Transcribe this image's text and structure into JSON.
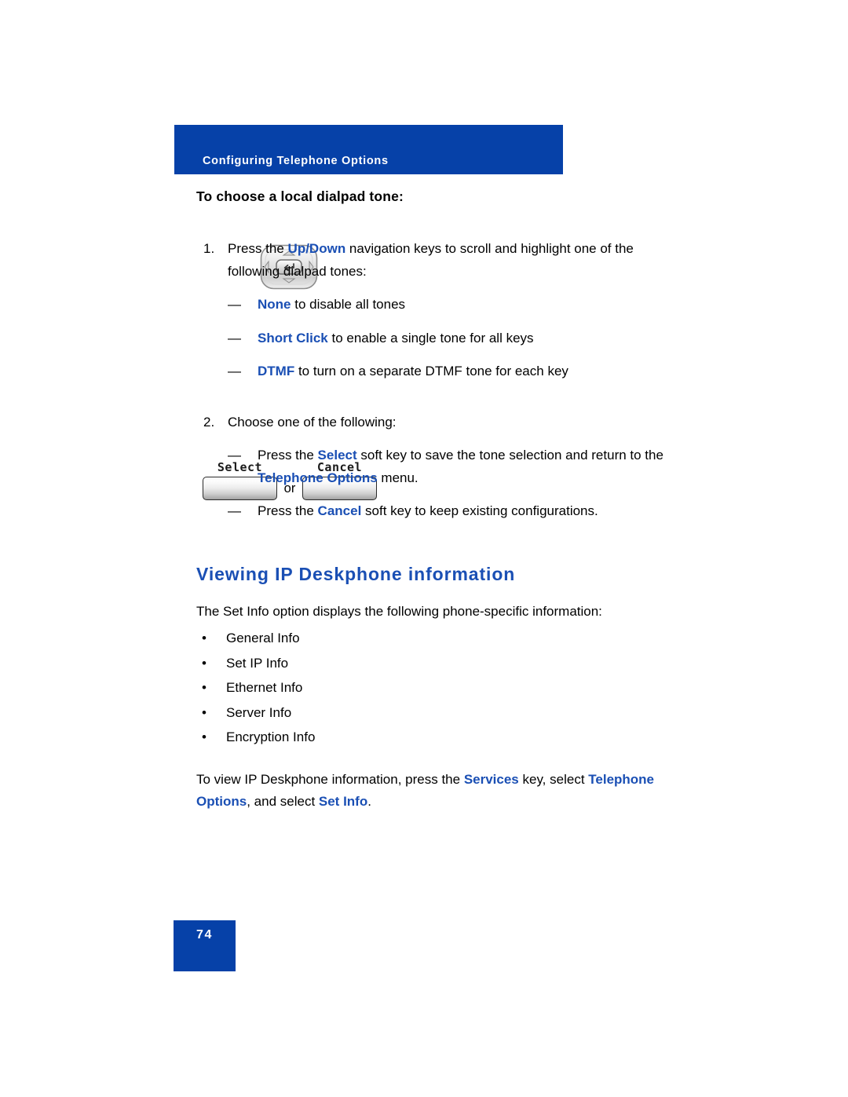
{
  "header": {
    "running_head": "Configuring Telephone Options"
  },
  "procedure": {
    "title": "To choose a local dialpad tone:",
    "steps": [
      {
        "number": "1.",
        "lead_pre": "Press the ",
        "lead_bold": "Up/Down",
        "lead_post": " navigation keys to scroll and highlight one of the following dialpad tones:",
        "dash": "—",
        "substeps": [
          {
            "bold": "None",
            "text": " to disable all tones"
          },
          {
            "bold": "Short Click",
            "text": " to enable a single tone for all keys"
          },
          {
            "bold": "DTMF",
            "text": " to turn on a separate DTMF tone for each key"
          }
        ]
      },
      {
        "number": "2.",
        "lead_pre": "Choose one of the following:",
        "lead_bold": "",
        "lead_post": "",
        "dash": "—",
        "substeps": [
          {
            "pre": "Press the ",
            "bold": "Select",
            "mid": " soft key to save the tone selection and return to the ",
            "bold2": "Telephone Options",
            "post": " menu."
          },
          {
            "pre": "Press the ",
            "bold": "Cancel",
            "mid": " soft key to keep existing configurations.",
            "bold2": "",
            "post": ""
          }
        ]
      }
    ]
  },
  "figures": {
    "nav_key": {
      "name": "navigation-keys",
      "icon": "navigation-cluster-icon"
    },
    "softkeys": {
      "select_label": "Select",
      "or_label": "or",
      "cancel_label": "Cancel"
    }
  },
  "section": {
    "heading": "Viewing IP Deskphone information",
    "intro": "The Set Info option displays the following phone-specific information:",
    "bullet": "•",
    "items": [
      "General Info",
      "Set IP Info",
      "Ethernet Info",
      "Server Info",
      "Encryption Info"
    ],
    "closing": {
      "pre": "To view IP Deskphone information, press the ",
      "bold1": "Services",
      "mid1": " key, select ",
      "bold2": "Telephone Options",
      "mid2": ", and select ",
      "bold3": "Set Info",
      "post": "."
    }
  },
  "footer": {
    "page_number": "74"
  },
  "colors": {
    "brand_blue": "#0641a8",
    "accent_blue": "#1a4fb4",
    "text_black": "#000000",
    "page_white": "#ffffff"
  }
}
